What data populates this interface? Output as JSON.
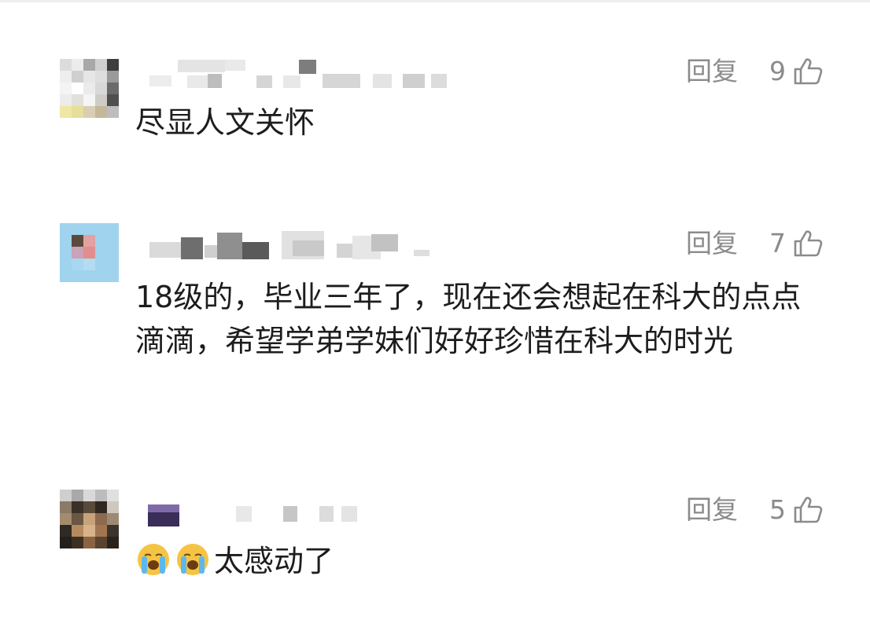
{
  "comments": [
    {
      "reply_label": "回复",
      "like_count": "9",
      "text": "尽显人文关怀",
      "avatar_colors": [
        "#dcdcdc",
        "#ececec",
        "#a8a8a8",
        "#d0d0d0",
        "#3e3e3e",
        "#eeeeee",
        "#cfcfcf",
        "#e6e6e6",
        "#dedede",
        "#9a9a9a",
        "#f4f4f4",
        "#ffffff",
        "#ebebeb",
        "#d8d8d8",
        "#6b6b6b",
        "#ececec",
        "#e3dfdb",
        "#f5f5f5",
        "#cfcbc6",
        "#4f4f4f",
        "#f1e6a3",
        "#e7de9b",
        "#d9cdb4",
        "#c4b89a",
        "#bdbdbd"
      ]
    },
    {
      "reply_label": "回复",
      "like_count": "7",
      "text": "18级的，毕业三年了，现在还会想起在科大的点点滴滴，希望学弟学妹们好好珍惜在科大的时光",
      "avatar_colors": [
        "#9fd3ee",
        "#9fd3ee",
        "#9fd3ee",
        "#9fd3ee",
        "#9fd3ee",
        "#9fd3ee",
        "#5a4a3c",
        "#e4a1a1",
        "#9fd3ee",
        "#9fd3ee",
        "#9fd3ee",
        "#c9a3b9",
        "#e08e8e",
        "#9fd3ee",
        "#9fd3ee",
        "#9fd3ee",
        "#a8d8f0",
        "#b3dcf2",
        "#9fd3ee",
        "#9fd3ee",
        "#9fd3ee",
        "#9fd3ee",
        "#9fd3ee",
        "#9fd3ee",
        "#9fd3ee"
      ]
    },
    {
      "reply_label": "回复",
      "like_count": "5",
      "text": "太感动了",
      "avatar_colors": [
        "#cfcfcf",
        "#a9a9a9",
        "#d9d9d9",
        "#bcbcbc",
        "#e0e0e0",
        "#8a7a66",
        "#3a3127",
        "#5a4a39",
        "#2e2820",
        "#d0c8bd",
        "#a38b6f",
        "#6b5644",
        "#c8a27a",
        "#8c6a4e",
        "#9e8a74",
        "#2f2a24",
        "#b48a5e",
        "#d6b38b",
        "#a07652",
        "#3a342c",
        "#241f1a",
        "#3d3023",
        "#8a6441",
        "#5a4430",
        "#2a231c"
      ]
    }
  ],
  "emoji_icon": "crying-face-emoji",
  "like_icon": "thumbs-up-outline-icon"
}
